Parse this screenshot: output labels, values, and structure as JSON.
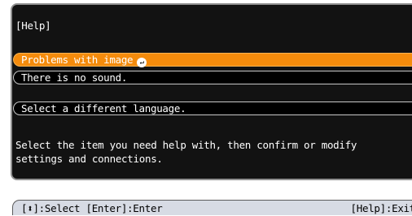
{
  "help_panel": {
    "title": "[Help]",
    "items": [
      {
        "label": "Problems with image",
        "selected": true,
        "icon": "enter-icon"
      },
      {
        "label": "There is no sound.",
        "selected": false
      },
      {
        "label": "Select a different language.",
        "selected": false
      }
    ],
    "message_line1": "Select the item you need help with, then confirm or modify",
    "message_line2": "settings and connections."
  },
  "status_bar": {
    "left": "[⬍]:Select [Enter]:Enter",
    "right": "[Help]:Exit"
  },
  "colors": {
    "panel_background": "#121212",
    "selected_item": "#f48b0c",
    "status_bar": "#d7dbe4"
  }
}
